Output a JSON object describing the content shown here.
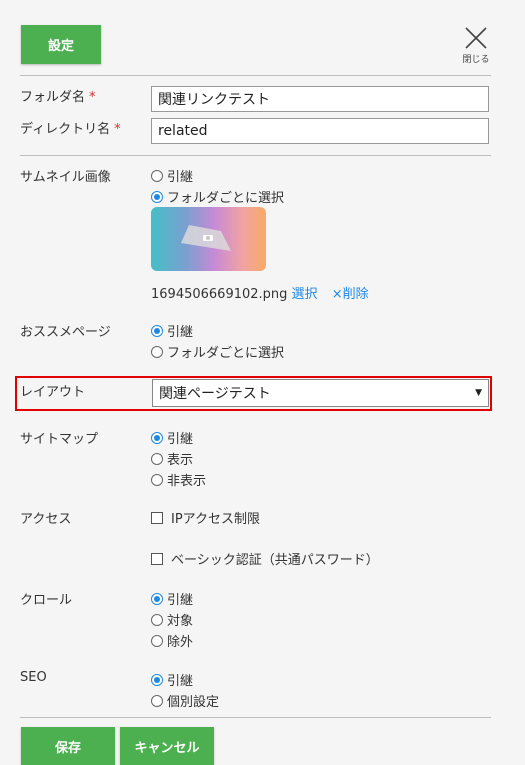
{
  "header": {
    "settings_label": "設定",
    "close_label": "閉じる"
  },
  "fields": {
    "folder_name_label": "フォルダ名",
    "folder_name_value": "関連リンクテスト",
    "directory_name_label": "ディレクトリ名",
    "directory_name_value": "related",
    "required_mark": "*"
  },
  "thumbnail": {
    "label": "サムネイル画像",
    "option_inherit": "引継",
    "option_per_folder": "フォルダごとに選択",
    "selected": "フォルダごとに選択",
    "filename": "1694506669102.png",
    "select_link": "選択",
    "delete_link": "×削除"
  },
  "recommended": {
    "label": "おススメページ",
    "option_inherit": "引継",
    "option_per_folder": "フォルダごとに選択",
    "selected": "引継"
  },
  "layout": {
    "label": "レイアウト",
    "selected_value": "関連ページテスト"
  },
  "sitemap": {
    "label": "サイトマップ",
    "option_inherit": "引継",
    "option_show": "表示",
    "option_hide": "非表示",
    "selected": "引継"
  },
  "access": {
    "label": "アクセス",
    "ip_restriction": "IPアクセス制限",
    "basic_auth": "ベーシック認証（共通パスワード）"
  },
  "crawl": {
    "label": "クロール",
    "option_inherit": "引継",
    "option_target": "対象",
    "option_exclude": "除外",
    "selected": "引継"
  },
  "seo": {
    "label": "SEO",
    "option_inherit": "引継",
    "option_individual": "個別設定",
    "selected": "引継"
  },
  "footer": {
    "save_label": "保存",
    "cancel_label": "キャンセル"
  },
  "colors": {
    "accent_green": "#4caf50",
    "link_blue": "#1e88e5",
    "highlight_red": "#e00000",
    "required_red": "#d32f2f"
  }
}
